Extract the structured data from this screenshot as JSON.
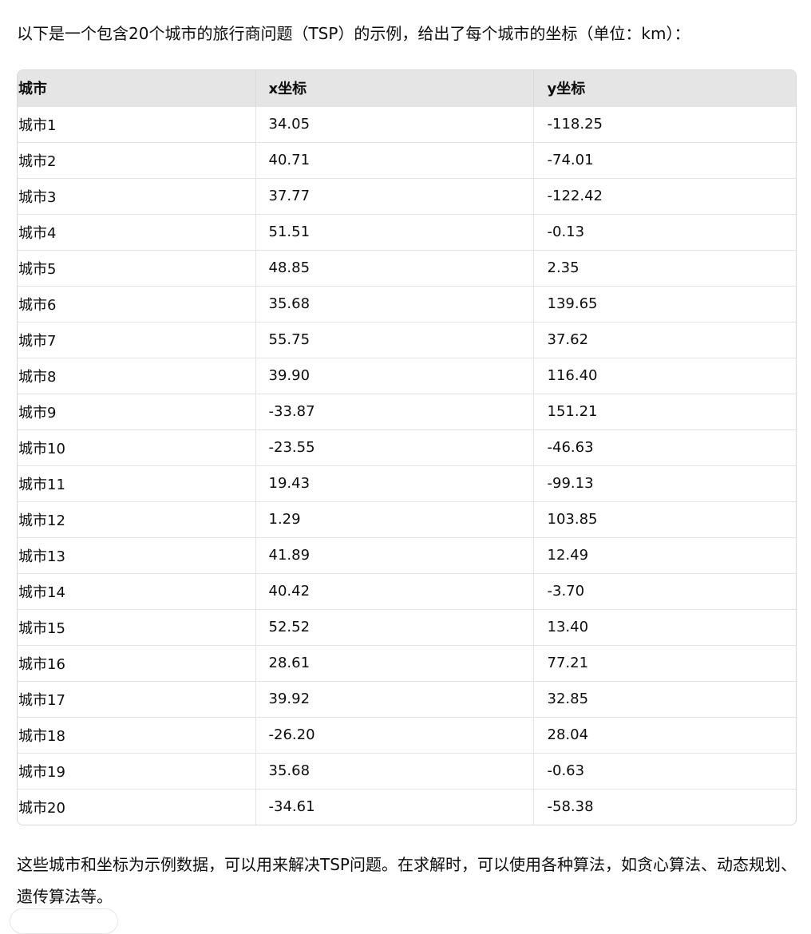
{
  "intro": "以下是一个包含20个城市的旅行商问题（TSP）的示例，给出了每个城市的坐标（单位：km）：",
  "table": {
    "headers": [
      "城市",
      "x坐标",
      "y坐标"
    ],
    "rows": [
      [
        "城市1",
        "34.05",
        "-118.25"
      ],
      [
        "城市2",
        "40.71",
        "-74.01"
      ],
      [
        "城市3",
        "37.77",
        "-122.42"
      ],
      [
        "城市4",
        "51.51",
        "-0.13"
      ],
      [
        "城市5",
        "48.85",
        "2.35"
      ],
      [
        "城市6",
        "35.68",
        "139.65"
      ],
      [
        "城市7",
        "55.75",
        "37.62"
      ],
      [
        "城市8",
        "39.90",
        "116.40"
      ],
      [
        "城市9",
        "-33.87",
        "151.21"
      ],
      [
        "城市10",
        "-23.55",
        "-46.63"
      ],
      [
        "城市11",
        "19.43",
        "-99.13"
      ],
      [
        "城市12",
        "1.29",
        "103.85"
      ],
      [
        "城市13",
        "41.89",
        "12.49"
      ],
      [
        "城市14",
        "40.42",
        "-3.70"
      ],
      [
        "城市15",
        "52.52",
        "13.40"
      ],
      [
        "城市16",
        "28.61",
        "77.21"
      ],
      [
        "城市17",
        "39.92",
        "32.85"
      ],
      [
        "城市18",
        "-26.20",
        "28.04"
      ],
      [
        "城市19",
        "35.68",
        "-0.63"
      ],
      [
        "城市20",
        "-34.61",
        "-58.38"
      ]
    ]
  },
  "outro": "这些城市和坐标为示例数据，可以用来解决TSP问题。在求解时，可以使用各种算法，如贪心算法、动态规划、遗传算法等。"
}
